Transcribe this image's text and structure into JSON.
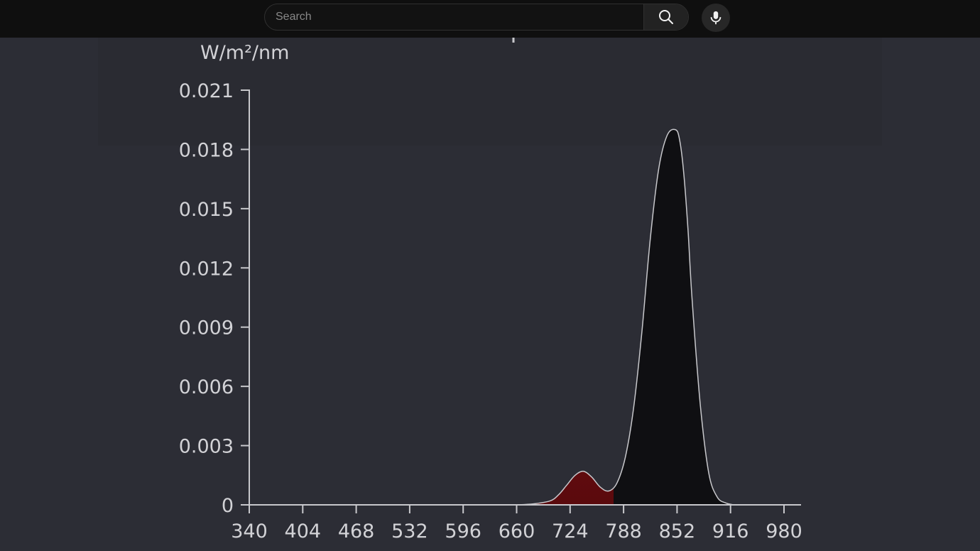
{
  "search": {
    "placeholder": "Search"
  },
  "icons": {
    "search": "search-icon",
    "mic": "microphone-icon"
  },
  "colors": {
    "topbar": "#0f0f0f",
    "background": "#2c2d35",
    "axis": "#c8c8cc",
    "peak_red": "#8c1115",
    "peak_dark": "#0f0f12",
    "curve_outline": "#c8c8cc"
  },
  "chart_data": {
    "type": "area",
    "ylabel": "W/m²/nm",
    "xlabel": "",
    "title": "",
    "x_ticks": [
      "340",
      "404",
      "468",
      "532",
      "596",
      "660",
      "724",
      "788",
      "852",
      "916",
      "980"
    ],
    "y_ticks": [
      "0",
      "0.003",
      "0.006",
      "0.009",
      "0.012",
      "0.015",
      "0.018",
      "0.021"
    ],
    "xlim": [
      340,
      980
    ],
    "ylim": [
      0,
      0.021
    ],
    "grid": false,
    "legend": "none",
    "series": [
      {
        "x": [
          660,
          680,
          700,
          710,
          720,
          730,
          740,
          750,
          760,
          770,
          780,
          790,
          800,
          810,
          820,
          830,
          840,
          850,
          855,
          860,
          865,
          870,
          880,
          890,
          900,
          910,
          920
        ],
        "y": [
          0,
          5e-05,
          0.0002,
          0.0005,
          0.001,
          0.0015,
          0.0017,
          0.0014,
          0.0009,
          0.0007,
          0.0011,
          0.0024,
          0.0049,
          0.0088,
          0.0135,
          0.017,
          0.0187,
          0.019,
          0.0185,
          0.0168,
          0.014,
          0.0104,
          0.005,
          0.0016,
          0.0004,
          0.0001,
          0
        ]
      }
    ],
    "red_band_end": 776
  }
}
